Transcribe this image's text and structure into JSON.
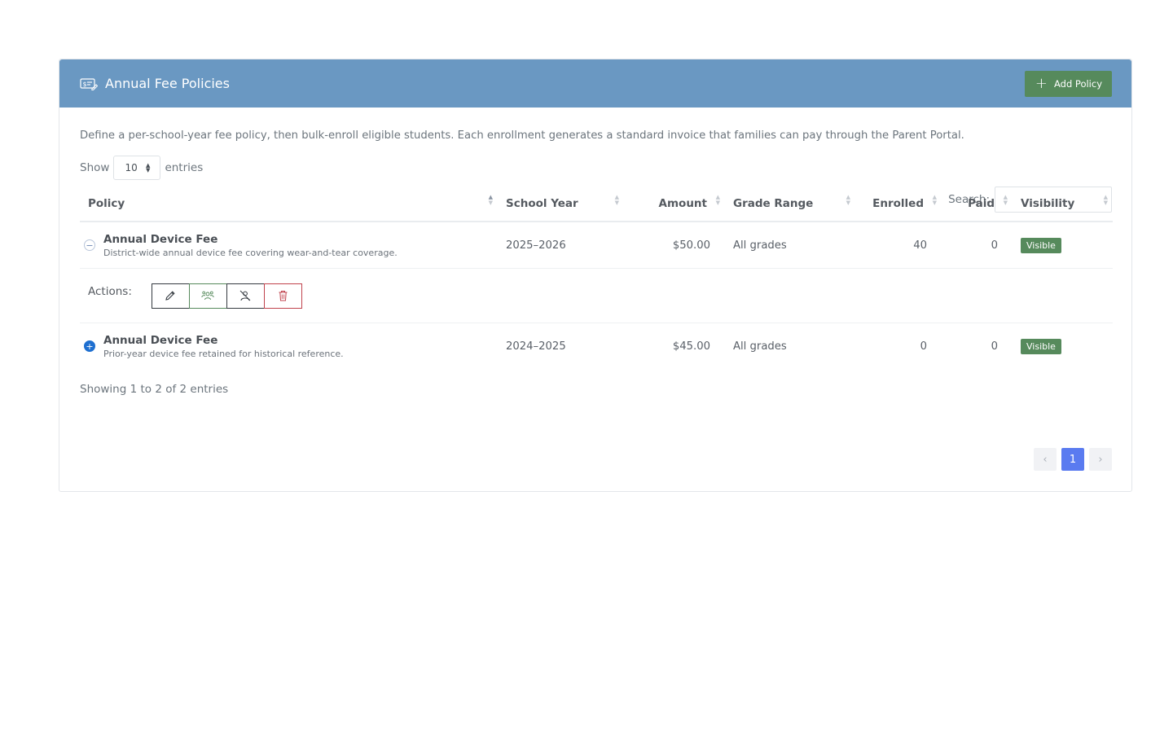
{
  "header": {
    "title": "Annual Fee Policies",
    "add_label": "Add Policy"
  },
  "description": "Define a per-school-year fee policy, then bulk-enroll eligible students. Each enrollment generates a standard invoice that families can pay through the Parent Portal.",
  "length": {
    "show": "Show",
    "value": "10",
    "entries": "entries"
  },
  "search": {
    "label": "Search:",
    "value": ""
  },
  "columns": {
    "policy": "Policy",
    "school_year": "School Year",
    "amount": "Amount",
    "grade_range": "Grade Range",
    "enrolled": "Enrolled",
    "paid": "Paid",
    "visibility": "Visibility"
  },
  "rows": [
    {
      "name": "Annual Device Fee",
      "subtitle": "District-wide annual device fee covering wear-and-tear coverage.",
      "school_year": "2025–2026",
      "amount": "$50.00",
      "grade_range": "All grades",
      "enrolled": "40",
      "paid": "0",
      "visibility": "Visible"
    },
    {
      "name": "Annual Device Fee",
      "subtitle": "Prior-year device fee retained for historical reference.",
      "school_year": "2024–2025",
      "amount": "$45.00",
      "grade_range": "All grades",
      "enrolled": "0",
      "paid": "0",
      "visibility": "Visible"
    }
  ],
  "actions": {
    "label": "Actions:"
  },
  "footer": {
    "info": "Showing 1 to 2 of 2 entries",
    "page": "1"
  },
  "colors": {
    "header_bg": "#6a98c2",
    "success": "#568a5c",
    "danger": "#c0424c",
    "page_active": "#5a7bf0"
  }
}
